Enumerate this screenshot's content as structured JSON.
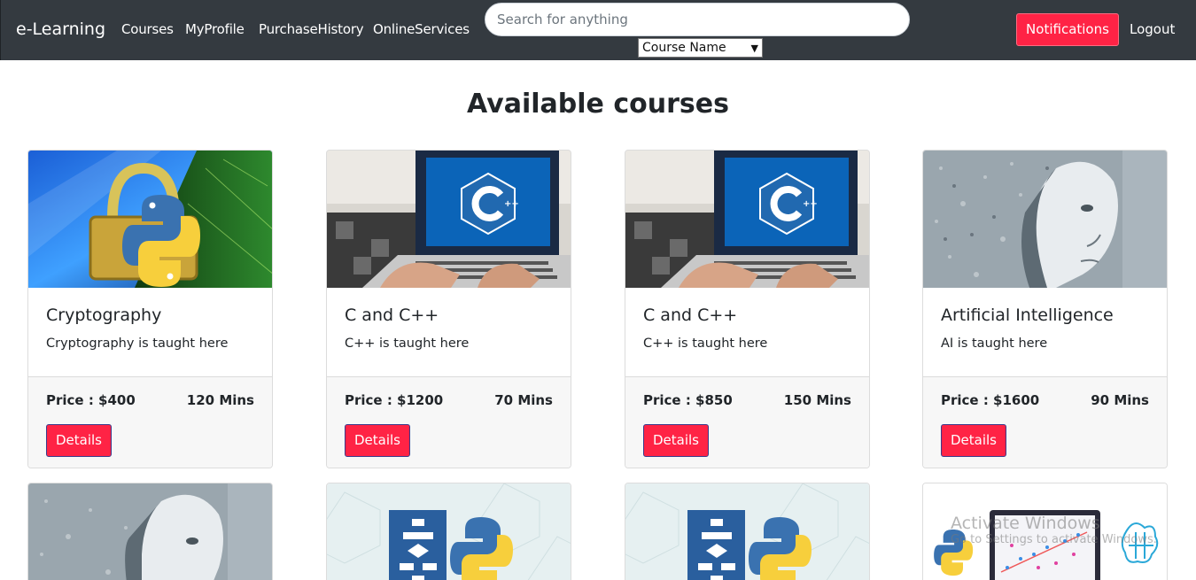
{
  "navbar": {
    "brand": "e-Learning",
    "links": [
      "Courses",
      "MyProfile",
      "PurchaseHistory",
      "OnlineServices"
    ],
    "search_placeholder": "Search for anything",
    "search_value": "",
    "filter_selected": "Course Name",
    "notifications_label": "Notifications",
    "logout_label": "Logout",
    "accent_color": "#ff2345",
    "bg_color": "#343a40"
  },
  "page_title": "Available courses",
  "courses": [
    {
      "title": "Cryptography",
      "description": "Cryptography is taught here",
      "price": "Price : $400",
      "duration": "120 Mins",
      "details_label": "Details",
      "image": "padlock-python-image"
    },
    {
      "title": "C and C++",
      "description": "C++ is taught here",
      "price": "Price : $1200",
      "duration": "70 Mins",
      "details_label": "Details",
      "image": "laptop-cpp-image"
    },
    {
      "title": "C and C++",
      "description": "C++ is taught here",
      "price": "Price : $850",
      "duration": "150 Mins",
      "details_label": "Details",
      "image": "laptop-cpp-image"
    },
    {
      "title": "Artificial Intelligence",
      "description": "AI is taught here",
      "price": "Price : $1600",
      "duration": "90 Mins",
      "details_label": "Details",
      "image": "ai-face-image"
    }
  ],
  "courses_row2_images": [
    "ai-face-image",
    "flowchart-python-image",
    "flowchart-python-image",
    "python-ml-image"
  ],
  "watermark": {
    "line1": "Activate Windows",
    "line2": "Go to Settings to activate Windows."
  }
}
